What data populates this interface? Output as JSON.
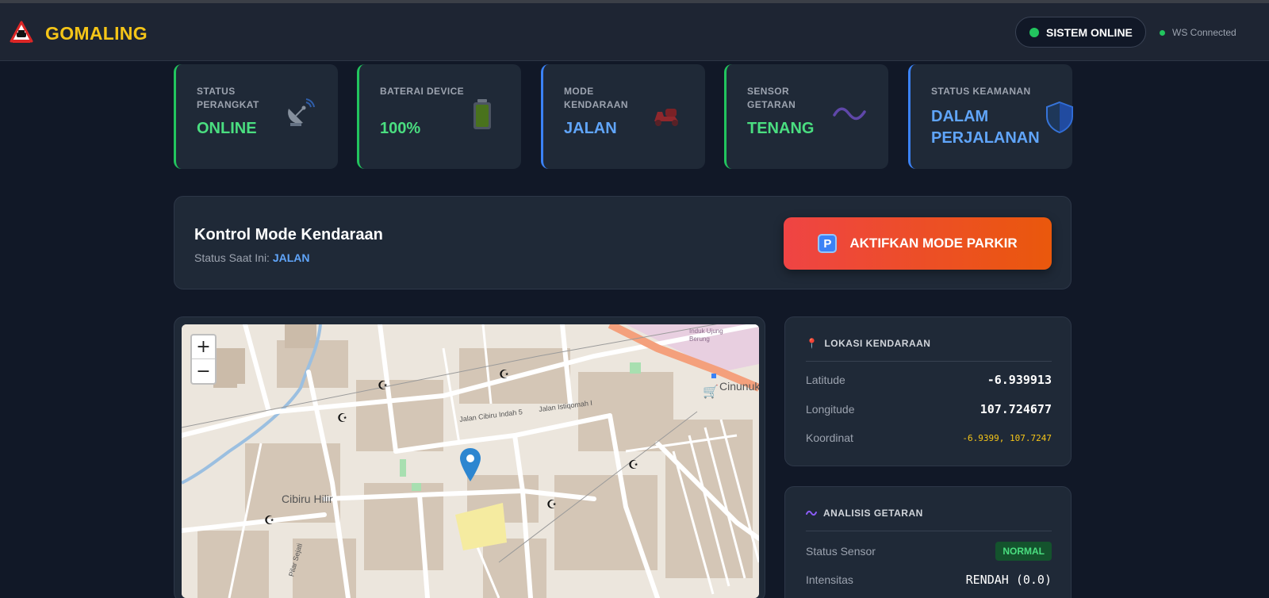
{
  "header": {
    "brand": "GOMALING",
    "logo_icon": "warning-car-icon",
    "system_status": "SISTEM ONLINE",
    "ws_status": "WS Connected",
    "status_color": "#22c55e"
  },
  "cards": [
    {
      "label": "STATUS PERANGKAT",
      "value": "ONLINE",
      "icon": "satellite-dish-icon"
    },
    {
      "label": "BATERAI DEVICE",
      "value": "100%",
      "icon": "battery-icon"
    },
    {
      "label": "MODE KENDARAAN",
      "value": "JALAN",
      "icon": "scooter-icon"
    },
    {
      "label": "SENSOR GETARAN",
      "value": "TENANG",
      "icon": "wave-icon"
    },
    {
      "label": "STATUS KEAMANAN",
      "value": "DALAM PERJALANAN",
      "icon": "shield-icon"
    }
  ],
  "control": {
    "title": "Kontrol Mode Kendaraan",
    "status_prefix": "Status Saat Ini:",
    "status_value": "JALAN",
    "button_label": "AKTIFKAN MODE PARKIR",
    "button_icon": "P"
  },
  "map": {
    "zoom_in": "+",
    "zoom_out": "−",
    "labels": [
      "Cibiru Hilir",
      "Cinunuk",
      "Jalan Cibiru Indah 5",
      "Jalan Istiqomah I",
      "Pilar Sejati",
      "Induk Ujung Berung"
    ]
  },
  "location": {
    "title": "LOKASI KENDARAAN",
    "latitude_label": "Latitude",
    "latitude": "-6.939913",
    "longitude_label": "Longitude",
    "longitude": "107.724677",
    "coord_label": "Koordinat",
    "coord": "-6.9399, 107.7247"
  },
  "vibration": {
    "title": "ANALISIS GETARAN",
    "status_label": "Status Sensor",
    "status": "NORMAL",
    "intensity_label": "Intensitas",
    "intensity": "RENDAH (0.0)"
  }
}
